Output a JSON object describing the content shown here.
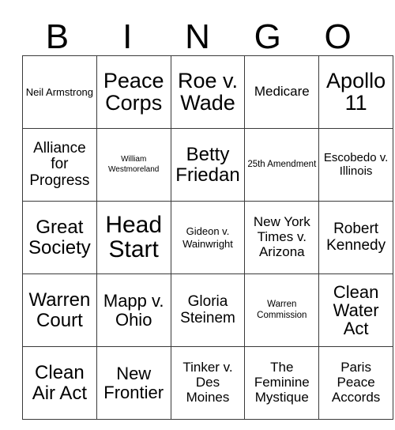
{
  "card": {
    "header_letters": [
      "B",
      "I",
      "N",
      "G",
      "O"
    ],
    "border_color": "#3a3a3a",
    "background_color": "#ffffff",
    "text_color": "#000000",
    "rows": [
      [
        {
          "text": "Neil Armstrong",
          "size": "fs-sm"
        },
        {
          "text": "Peace Corps",
          "size": "fs-h1"
        },
        {
          "text": "Roe v. Wade",
          "size": "fs-h1"
        },
        {
          "text": "Medicare",
          "size": "fs-ml"
        },
        {
          "text": "Apollo 11",
          "size": "fs-h1"
        }
      ],
      [
        {
          "text": "Alliance for Progress",
          "size": "fs-l"
        },
        {
          "text": "William Westmoreland",
          "size": "fs-xs"
        },
        {
          "text": "Betty Friedan",
          "size": "fs-xxl"
        },
        {
          "text": "25th Amendment",
          "size": "fs-s"
        },
        {
          "text": "Escobedo v. Illinois",
          "size": "fs-m"
        }
      ],
      [
        {
          "text": "Great Society",
          "size": "fs-xxl"
        },
        {
          "text": "Head Start",
          "size": "fs-h2"
        },
        {
          "text": "Gideon v. Wainwright",
          "size": "fs-sm"
        },
        {
          "text": "New York Times v. Arizona",
          "size": "fs-ml"
        },
        {
          "text": "Robert Kennedy",
          "size": "fs-l"
        }
      ],
      [
        {
          "text": "Warren Court",
          "size": "fs-xxl"
        },
        {
          "text": "Mapp v. Ohio",
          "size": "fs-xl"
        },
        {
          "text": "Gloria Steinem",
          "size": "fs-l"
        },
        {
          "text": "Warren Commission",
          "size": "fs-s"
        },
        {
          "text": "Clean Water Act",
          "size": "fs-xl"
        }
      ],
      [
        {
          "text": "Clean Air Act",
          "size": "fs-xxl"
        },
        {
          "text": "New Frontier",
          "size": "fs-xl"
        },
        {
          "text": "Tinker v. Des Moines",
          "size": "fs-ml"
        },
        {
          "text": "The Feminine Mystique",
          "size": "fs-ml"
        },
        {
          "text": "Paris Peace Accords",
          "size": "fs-ml"
        }
      ]
    ]
  }
}
